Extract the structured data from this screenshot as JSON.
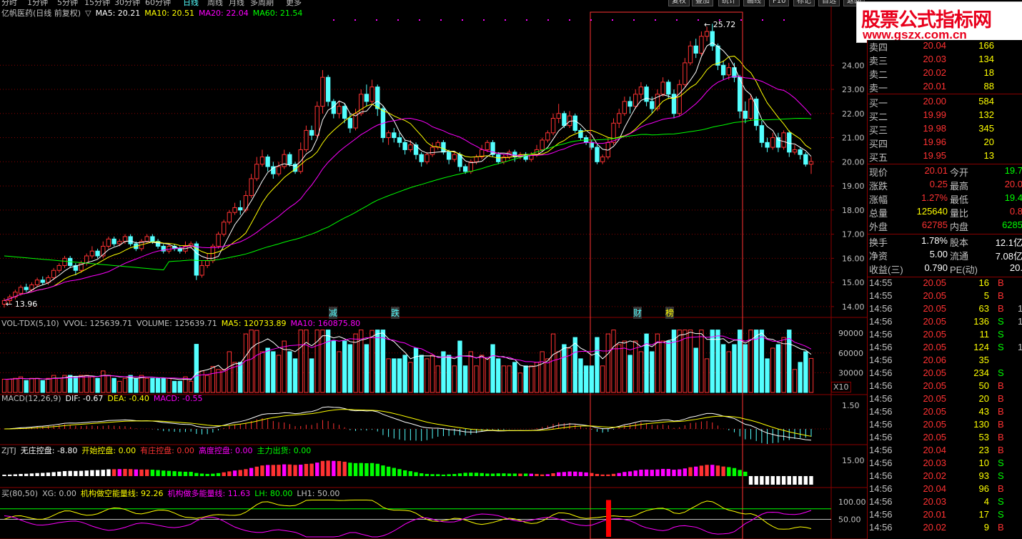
{
  "topbar": {
    "items": [
      "分时",
      "1分钟",
      "5分钟",
      "15分钟",
      "30分钟",
      "60分钟",
      "日线",
      "周线",
      "月线",
      "多周期",
      "更多"
    ],
    "buttons": [
      "复权",
      "叠加",
      "统计",
      "画线",
      "F10",
      "标记",
      "自选",
      "返回"
    ]
  },
  "watermark": {
    "line1": "股票公式指标网",
    "line2": "www.gszx.com.cn"
  },
  "panels": {
    "main": {
      "title": "亿帆医药(日线 前复权)",
      "ma5": "MA5: 20.21",
      "ma10": "MA10: 20.51",
      "ma20": "MA20: 22.04",
      "ma60": "MA60: 21.54",
      "yticks": [
        "24.00",
        "23.00",
        "22.00",
        "21.00",
        "20.00",
        "19.00",
        "18.00",
        "17.00",
        "16.00",
        "15.00",
        "14.00"
      ],
      "high_label": "25.72",
      "low_label": "13.96",
      "markers": [
        "减",
        "跌",
        "财",
        "榜"
      ]
    },
    "vol": {
      "title": "VOL-TDX(5,10)",
      "vvol": "VVOL: 125639.71",
      "volume": "VOLUME: 125639.71",
      "ma5": "MA5: 120733.89",
      "ma10": "MA10: 160875.80",
      "yticks": [
        "90000",
        "60000",
        "30000"
      ],
      "unit": "X10"
    },
    "macd": {
      "title": "MACD(12,26,9)",
      "dif": "DIF: -0.67",
      "dea": "DEA: -0.40",
      "macd": "MACD: -0.55",
      "yticks": [
        "1.50"
      ]
    },
    "zjtj": {
      "title": "ZJTJ",
      "a": "无庄控盘: -8.80",
      "b": "开始控盘: 0.00",
      "c": "有庄控盘: 0.00",
      "d": "高度控盘: 0.00",
      "e": "主力出货: 0.00",
      "yticks": [
        "15.00"
      ]
    },
    "buy": {
      "title": "买(80,50)",
      "xg": "XG: 0.00",
      "k1": "机构做空能量线: 92.26",
      "k2": "机构做多能量线: 11.63",
      "lh": "LH: 80.00",
      "lh1": "LH1: 50.00",
      "yticks": [
        "100.00",
        "50.00"
      ]
    }
  },
  "colors": {
    "up": "#ff3232",
    "down": "#54ffff",
    "ma5": "#ffffff",
    "ma10": "#ffff00",
    "ma20": "#ff00ff",
    "ma60": "#00ff00",
    "grid": "#8b0000",
    "label": "#c0c0c0"
  },
  "chart_data": {
    "type": "candlestick",
    "candles": [
      [
        14.1,
        14.25,
        13.96,
        14.35
      ],
      [
        14.25,
        14.4,
        14.1,
        14.5
      ],
      [
        14.4,
        14.6,
        14.3,
        14.7
      ],
      [
        14.55,
        14.8,
        14.45,
        14.9
      ],
      [
        14.8,
        14.7,
        14.6,
        14.95
      ],
      [
        14.7,
        14.9,
        14.6,
        15.0
      ],
      [
        14.9,
        15.1,
        14.8,
        15.2
      ],
      [
        15.1,
        15.0,
        14.9,
        15.25
      ],
      [
        15.0,
        15.2,
        14.9,
        15.3
      ],
      [
        15.2,
        15.5,
        15.1,
        15.6
      ],
      [
        15.5,
        15.7,
        15.4,
        15.8
      ],
      [
        15.7,
        16.0,
        15.6,
        16.1
      ],
      [
        16.0,
        15.7,
        15.6,
        16.1
      ],
      [
        15.7,
        15.5,
        15.3,
        15.8
      ],
      [
        15.5,
        15.8,
        15.4,
        15.9
      ],
      [
        15.8,
        16.1,
        15.7,
        16.2
      ],
      [
        16.1,
        16.3,
        16.0,
        16.5
      ],
      [
        16.3,
        16.1,
        16.0,
        16.4
      ],
      [
        16.1,
        16.5,
        16.0,
        16.7
      ],
      [
        16.5,
        16.8,
        16.4,
        16.9
      ],
      [
        16.8,
        16.6,
        16.5,
        16.9
      ],
      [
        16.6,
        16.7,
        16.5,
        16.8
      ],
      [
        16.7,
        16.9,
        16.6,
        17.0
      ],
      [
        16.9,
        16.6,
        16.5,
        17.0
      ],
      [
        16.6,
        16.4,
        16.3,
        16.7
      ],
      [
        16.4,
        16.7,
        16.3,
        16.8
      ],
      [
        16.7,
        16.9,
        16.6,
        17.0
      ],
      [
        16.9,
        16.7,
        16.6,
        17.0
      ],
      [
        16.7,
        16.5,
        16.4,
        16.8
      ],
      [
        16.5,
        16.3,
        16.2,
        16.6
      ],
      [
        16.3,
        16.5,
        16.2,
        16.6
      ],
      [
        16.5,
        16.4,
        16.3,
        16.6
      ],
      [
        16.4,
        16.3,
        16.2,
        16.5
      ],
      [
        16.3,
        16.5,
        16.2,
        16.7
      ],
      [
        16.5,
        16.6,
        16.4,
        16.7
      ],
      [
        16.6,
        15.3,
        15.1,
        16.7
      ],
      [
        15.3,
        15.7,
        15.2,
        15.9
      ],
      [
        15.7,
        15.9,
        15.6,
        16.2
      ],
      [
        15.9,
        16.5,
        15.8,
        16.6
      ],
      [
        16.5,
        17.0,
        16.4,
        17.1
      ],
      [
        17.0,
        17.5,
        16.9,
        17.6
      ],
      [
        17.5,
        17.9,
        17.4,
        18.0
      ],
      [
        17.9,
        18.1,
        17.8,
        18.3
      ],
      [
        18.1,
        18.0,
        17.8,
        18.4
      ],
      [
        18.0,
        18.6,
        17.9,
        18.8
      ],
      [
        18.6,
        19.3,
        18.5,
        19.5
      ],
      [
        19.3,
        19.9,
        19.2,
        20.2
      ],
      [
        19.9,
        20.2,
        19.8,
        20.5
      ],
      [
        20.2,
        19.8,
        19.6,
        20.3
      ],
      [
        19.8,
        19.5,
        19.3,
        20.0
      ],
      [
        19.5,
        19.8,
        19.4,
        20.0
      ],
      [
        19.8,
        20.3,
        19.7,
        20.5
      ],
      [
        20.3,
        19.9,
        19.8,
        20.4
      ],
      [
        19.9,
        19.6,
        19.5,
        20.0
      ],
      [
        19.6,
        20.5,
        19.5,
        20.8
      ],
      [
        20.5,
        21.3,
        20.4,
        21.5
      ],
      [
        21.3,
        21.1,
        20.9,
        21.5
      ],
      [
        21.1,
        22.3,
        21.0,
        22.5
      ],
      [
        22.3,
        23.5,
        22.0,
        23.8
      ],
      [
        23.5,
        22.5,
        22.3,
        23.6
      ],
      [
        22.5,
        22.0,
        21.8,
        22.6
      ],
      [
        22.0,
        22.3,
        21.8,
        22.5
      ],
      [
        22.3,
        21.8,
        21.6,
        22.4
      ],
      [
        21.8,
        21.4,
        21.2,
        22.0
      ],
      [
        21.4,
        22.0,
        21.3,
        22.2
      ],
      [
        22.0,
        22.8,
        21.9,
        23.0
      ],
      [
        22.8,
        22.5,
        22.3,
        23.2
      ],
      [
        22.5,
        23.1,
        22.4,
        23.4
      ],
      [
        23.1,
        22.2,
        21.9,
        23.2
      ],
      [
        22.2,
        21.0,
        20.8,
        22.3
      ],
      [
        21.0,
        21.2,
        20.7,
        21.3
      ],
      [
        21.2,
        21.0,
        20.8,
        21.4
      ],
      [
        21.0,
        20.8,
        20.6,
        21.2
      ],
      [
        20.8,
        20.5,
        20.3,
        20.9
      ],
      [
        20.5,
        20.7,
        20.4,
        20.9
      ],
      [
        20.7,
        20.3,
        20.1,
        20.8
      ],
      [
        20.3,
        20.0,
        19.8,
        20.4
      ],
      [
        20.0,
        20.3,
        19.9,
        20.4
      ],
      [
        20.3,
        20.6,
        20.2,
        20.8
      ],
      [
        20.6,
        20.8,
        20.5,
        20.9
      ],
      [
        20.8,
        20.4,
        20.3,
        20.9
      ],
      [
        20.4,
        20.1,
        19.9,
        20.5
      ],
      [
        20.1,
        20.3,
        20.0,
        20.4
      ],
      [
        20.3,
        19.8,
        19.6,
        20.4
      ],
      [
        19.8,
        19.6,
        19.5,
        19.9
      ],
      [
        19.6,
        20.0,
        19.5,
        20.1
      ],
      [
        20.0,
        20.2,
        19.9,
        20.3
      ],
      [
        20.2,
        20.5,
        20.1,
        20.7
      ],
      [
        20.5,
        20.8,
        20.4,
        20.9
      ],
      [
        20.8,
        20.3,
        20.2,
        20.9
      ],
      [
        20.3,
        20.0,
        19.9,
        20.4
      ],
      [
        20.0,
        20.2,
        19.9,
        20.3
      ],
      [
        20.2,
        20.4,
        20.1,
        20.5
      ],
      [
        20.4,
        20.2,
        20.0,
        20.5
      ],
      [
        20.2,
        20.3,
        20.1,
        20.4
      ],
      [
        20.3,
        20.1,
        20.0,
        20.4
      ],
      [
        20.1,
        20.3,
        20.0,
        20.4
      ],
      [
        20.3,
        20.5,
        20.2,
        20.7
      ],
      [
        20.5,
        20.9,
        20.4,
        21.0
      ],
      [
        20.9,
        21.2,
        20.8,
        21.3
      ],
      [
        21.2,
        21.8,
        21.1,
        22.0
      ],
      [
        21.8,
        22.0,
        21.6,
        22.4
      ],
      [
        22.0,
        21.5,
        21.4,
        22.1
      ],
      [
        21.5,
        21.9,
        21.4,
        22.1
      ],
      [
        21.9,
        21.3,
        21.2,
        22.0
      ],
      [
        21.3,
        21.0,
        20.9,
        21.4
      ],
      [
        21.0,
        20.8,
        20.7,
        21.1
      ],
      [
        20.8,
        20.6,
        20.5,
        20.9
      ],
      [
        20.6,
        20.0,
        19.9,
        20.7
      ],
      [
        20.0,
        20.2,
        19.9,
        20.3
      ],
      [
        20.2,
        20.8,
        20.1,
        21.0
      ],
      [
        20.8,
        21.6,
        20.7,
        21.8
      ],
      [
        21.6,
        22.0,
        21.4,
        22.2
      ],
      [
        22.0,
        22.5,
        21.9,
        22.7
      ],
      [
        22.5,
        22.3,
        22.0,
        22.7
      ],
      [
        22.3,
        22.8,
        22.2,
        23.0
      ],
      [
        22.8,
        23.1,
        22.6,
        23.3
      ],
      [
        23.1,
        22.5,
        22.3,
        23.2
      ],
      [
        22.5,
        22.2,
        22.0,
        22.7
      ],
      [
        22.2,
        22.8,
        22.1,
        23.0
      ],
      [
        22.8,
        23.3,
        22.7,
        23.5
      ],
      [
        23.3,
        22.8,
        22.6,
        23.4
      ],
      [
        22.8,
        22.0,
        21.8,
        23.0
      ],
      [
        22.0,
        23.2,
        21.9,
        23.4
      ],
      [
        23.2,
        24.1,
        23.1,
        24.3
      ],
      [
        24.1,
        24.8,
        24.0,
        25.0
      ],
      [
        24.8,
        24.5,
        24.3,
        25.1
      ],
      [
        24.5,
        25.2,
        24.4,
        25.4
      ],
      [
        25.2,
        25.4,
        25.0,
        25.6
      ],
      [
        25.4,
        24.8,
        24.6,
        25.72
      ],
      [
        24.8,
        24.0,
        23.8,
        24.9
      ],
      [
        24.0,
        23.6,
        23.4,
        24.2
      ],
      [
        23.6,
        23.9,
        23.4,
        24.1
      ],
      [
        23.9,
        23.5,
        23.3,
        24.1
      ],
      [
        23.5,
        22.1,
        21.8,
        23.6
      ],
      [
        22.1,
        21.8,
        21.6,
        22.5
      ],
      [
        21.8,
        22.6,
        21.7,
        22.8
      ],
      [
        22.6,
        21.5,
        21.3,
        22.7
      ],
      [
        21.5,
        20.8,
        20.6,
        21.7
      ],
      [
        20.8,
        20.6,
        20.4,
        21.0
      ],
      [
        20.6,
        21.0,
        20.5,
        21.2
      ],
      [
        21.0,
        20.6,
        20.4,
        21.2
      ],
      [
        20.6,
        21.2,
        20.5,
        21.3
      ],
      [
        21.2,
        20.4,
        20.2,
        21.3
      ],
      [
        20.4,
        20.5,
        20.3,
        20.7
      ],
      [
        20.5,
        20.3,
        20.1,
        20.6
      ],
      [
        20.3,
        19.9,
        19.8,
        20.4
      ],
      [
        19.9,
        20.01,
        19.5,
        20.2
      ]
    ]
  },
  "quote": {
    "sells": [
      [
        "卖四",
        "20.04",
        "166"
      ],
      [
        "卖三",
        "20.03",
        "134"
      ],
      [
        "卖二",
        "20.02",
        "18"
      ],
      [
        "卖一",
        "20.01",
        "88"
      ]
    ],
    "buys": [
      [
        "买一",
        "20.00",
        "584"
      ],
      [
        "买二",
        "19.99",
        "132"
      ],
      [
        "买三",
        "19.98",
        "345"
      ],
      [
        "买四",
        "19.96",
        "20"
      ],
      [
        "买五",
        "19.95",
        "13"
      ]
    ],
    "stats": [
      [
        "现价",
        "20.01",
        "今开",
        "19.7"
      ],
      [
        "涨跌",
        "0.25",
        "最高",
        "20.0"
      ],
      [
        "涨幅",
        "1.27%",
        "最低",
        "19.4"
      ],
      [
        "总量",
        "125640",
        "量比",
        "0.8"
      ],
      [
        "外盘",
        "62785",
        "内盘",
        "6285"
      ]
    ],
    "stats2": [
      [
        "换手",
        "1.78%",
        "股本",
        "12.1亿"
      ],
      [
        "净资",
        "5.00",
        "流通",
        "7.08亿"
      ],
      [
        "收益(三)",
        "0.790",
        "PE(动)",
        "20."
      ]
    ],
    "ticks": [
      [
        "14:55",
        "20.05",
        "16",
        "B",
        ""
      ],
      [
        "14:55",
        "20.05",
        "5",
        "B",
        ""
      ],
      [
        "14:56",
        "20.05",
        "63",
        "B",
        "1"
      ],
      [
        "14:56",
        "20.05",
        "136",
        "S",
        "1"
      ],
      [
        "14:56",
        "20.05",
        "11",
        "S",
        ""
      ],
      [
        "14:56",
        "20.05",
        "124",
        "S",
        "1"
      ],
      [
        "14:56",
        "20.06",
        "35",
        "",
        ""
      ],
      [
        "14:56",
        "20.05",
        "234",
        "S",
        ""
      ],
      [
        "14:56",
        "20.05",
        "50",
        "B",
        ""
      ],
      [
        "14:56",
        "20.05",
        "20",
        "B",
        ""
      ],
      [
        "14:56",
        "20.05",
        "43",
        "B",
        ""
      ],
      [
        "14:56",
        "20.05",
        "130",
        "B",
        ""
      ],
      [
        "14:56",
        "20.05",
        "53",
        "B",
        ""
      ],
      [
        "14:56",
        "20.04",
        "23",
        "B",
        ""
      ],
      [
        "14:56",
        "20.03",
        "10",
        "S",
        ""
      ],
      [
        "14:56",
        "20.02",
        "93",
        "S",
        ""
      ],
      [
        "14:56",
        "20.04",
        "96",
        "B",
        ""
      ],
      [
        "14:56",
        "20.03",
        "4",
        "S",
        ""
      ],
      [
        "14:56",
        "20.01",
        "17",
        "S",
        ""
      ],
      [
        "14:56",
        "20.02",
        "9",
        "B",
        ""
      ]
    ]
  }
}
